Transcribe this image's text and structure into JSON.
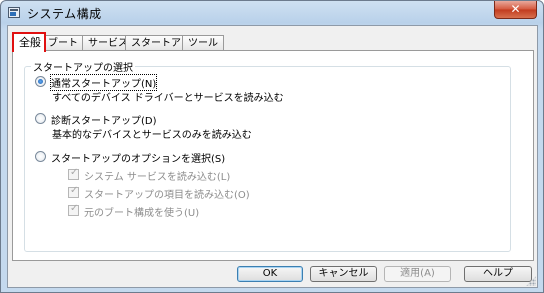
{
  "window": {
    "title": "システム構成",
    "close_glyph": "✕"
  },
  "tabs": [
    {
      "label": "全般",
      "active": true
    },
    {
      "label": "ブート",
      "active": false
    },
    {
      "label": "サービス",
      "active": false
    },
    {
      "label": "スタートアップ",
      "active": false
    },
    {
      "label": "ツール",
      "active": false
    }
  ],
  "startup_selection": {
    "legend": "スタートアップの選択",
    "options": [
      {
        "label": "通常スタートアップ(N)",
        "description": "すべてのデバイス ドライバーとサービスを読み込む",
        "selected": true
      },
      {
        "label": "診断スタートアップ(D)",
        "description": "基本的なデバイスとサービスのみを読み込む",
        "selected": false
      },
      {
        "label": "スタートアップのオプションを選択(S)",
        "selected": false
      }
    ],
    "selective_checks": [
      {
        "label": "システム サービスを読み込む(L)",
        "checked": true,
        "enabled": false
      },
      {
        "label": "スタートアップの項目を読み込む(O)",
        "checked": true,
        "enabled": false
      },
      {
        "label": "元のブート構成を使う(U)",
        "checked": true,
        "enabled": false
      }
    ]
  },
  "buttons": {
    "ok": "OK",
    "cancel": "キャンセル",
    "apply": "適用(A)",
    "help": "ヘルプ"
  },
  "colors": {
    "active_tab_highlight": "#e01010",
    "title_bar": "#b9d1ea",
    "close_button": "#c13b1e"
  },
  "icons": {
    "app": "msconfig-icon",
    "close": "close-icon"
  }
}
